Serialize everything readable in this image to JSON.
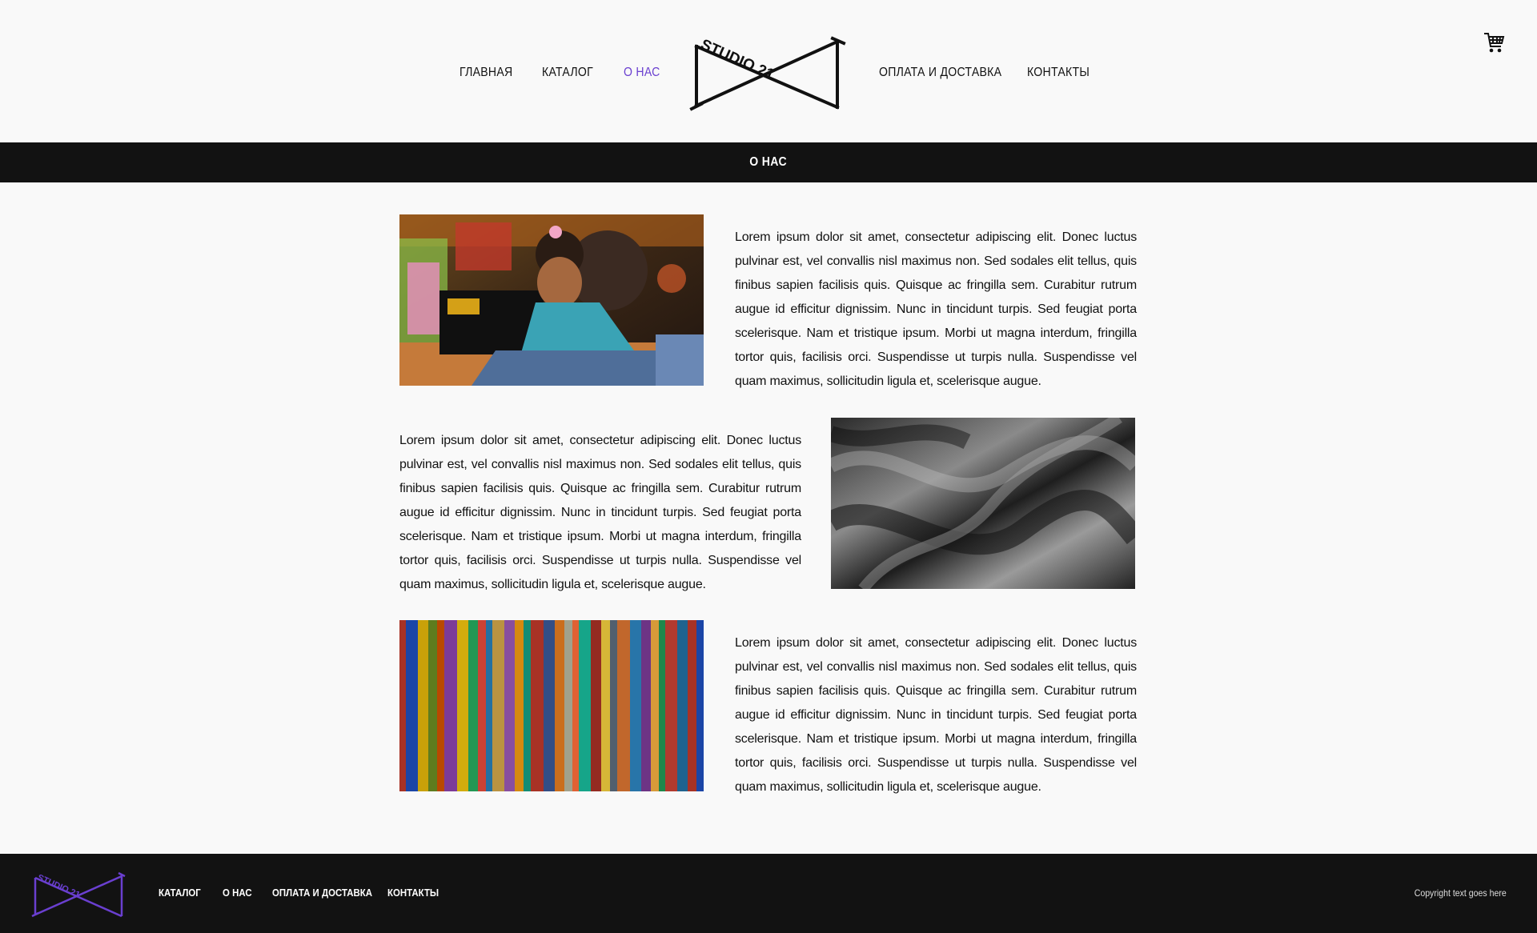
{
  "header": {
    "nav_left": [
      "ГЛАВНАЯ",
      "КАТАЛОГ",
      "О НАС"
    ],
    "nav_right": [
      "ОПЛАТА И ДОСТАВКА",
      "КОНТАКТЫ"
    ],
    "active_item": "О НАС",
    "logo_text": "STUDIO 21",
    "cart_icon": "cart-icon"
  },
  "page_title": "О НАС",
  "sections": [
    {
      "image": "sewing-machine-photo",
      "text": "Lorem ipsum dolor sit amet, consectetur adipiscing elit. Donec luctus pulvinar est, vel convallis nisl maximus non. Sed sodales elit tellus, quis finibus sapien facilisis quis. Quisque ac fringilla sem. Curabitur rutrum augue id efficitur dignissim. Nunc in tincidunt turpis. Sed feugiat porta scelerisque. Nam et tristique ipsum. Morbi ut magna interdum, fringilla tortor quis, facilisis orci. Suspendisse ut turpis nulla. Sus­pendisse vel quam maximus, sollicitudin ligula et, scelerisque augue."
    },
    {
      "image": "silk-fabric-photo",
      "text": "Lorem ipsum dolor sit amet, consectetur adipiscing elit. Donec luctus pulvinar est, vel convallis nisl maximus non. Sed sodales elit tellus, quis finibus sapien facilisis quis. Quisque ac fringilla sem. Curabitur rutrum augue id efficitur dignissim. Nunc in tincidunt turpis. Sed feugiat porta scelerisque. Nam et tristique ipsum. Morbi ut magna interdum, fringilla tortor quis, facilisis orci. Suspendisse ut turpis nulla. Sus­pendisse vel quam maximus, sollicitudin ligula et, scelerisque augue."
    },
    {
      "image": "colorful-fabrics-photo",
      "text": "Lorem ipsum dolor sit amet, consectetur adipiscing elit. Donec luctus pulvinar est, vel convallis nisl maximus non. Sed sodales elit tellus, quis finibus sapien facilisis quis. Quisque ac fringilla sem. Curabitur rutrum augue id efficitur dignissim. Nunc in tincidunt turpis. Sed feugiat porta scelerisque. Nam et tristique ipsum. Morbi ut magna interdum, fringilla tortor quis, facilisis orci. Suspendisse ut turpis nulla. Sus­pendisse vel quam maximus, sollicitudin ligula et, scelerisque augue."
    }
  ],
  "footer": {
    "nav": [
      "КАТАЛОГ",
      "О НАС",
      "ОПЛАТА И ДОСТАВКА",
      "КОНТАКТЫ"
    ],
    "copyright": "Copyright text goes here",
    "logo_text": "STUDIO 21"
  },
  "colors": {
    "accent": "#6a3fd0",
    "dark_bar": "#121212",
    "background": "#f9f9f9"
  }
}
